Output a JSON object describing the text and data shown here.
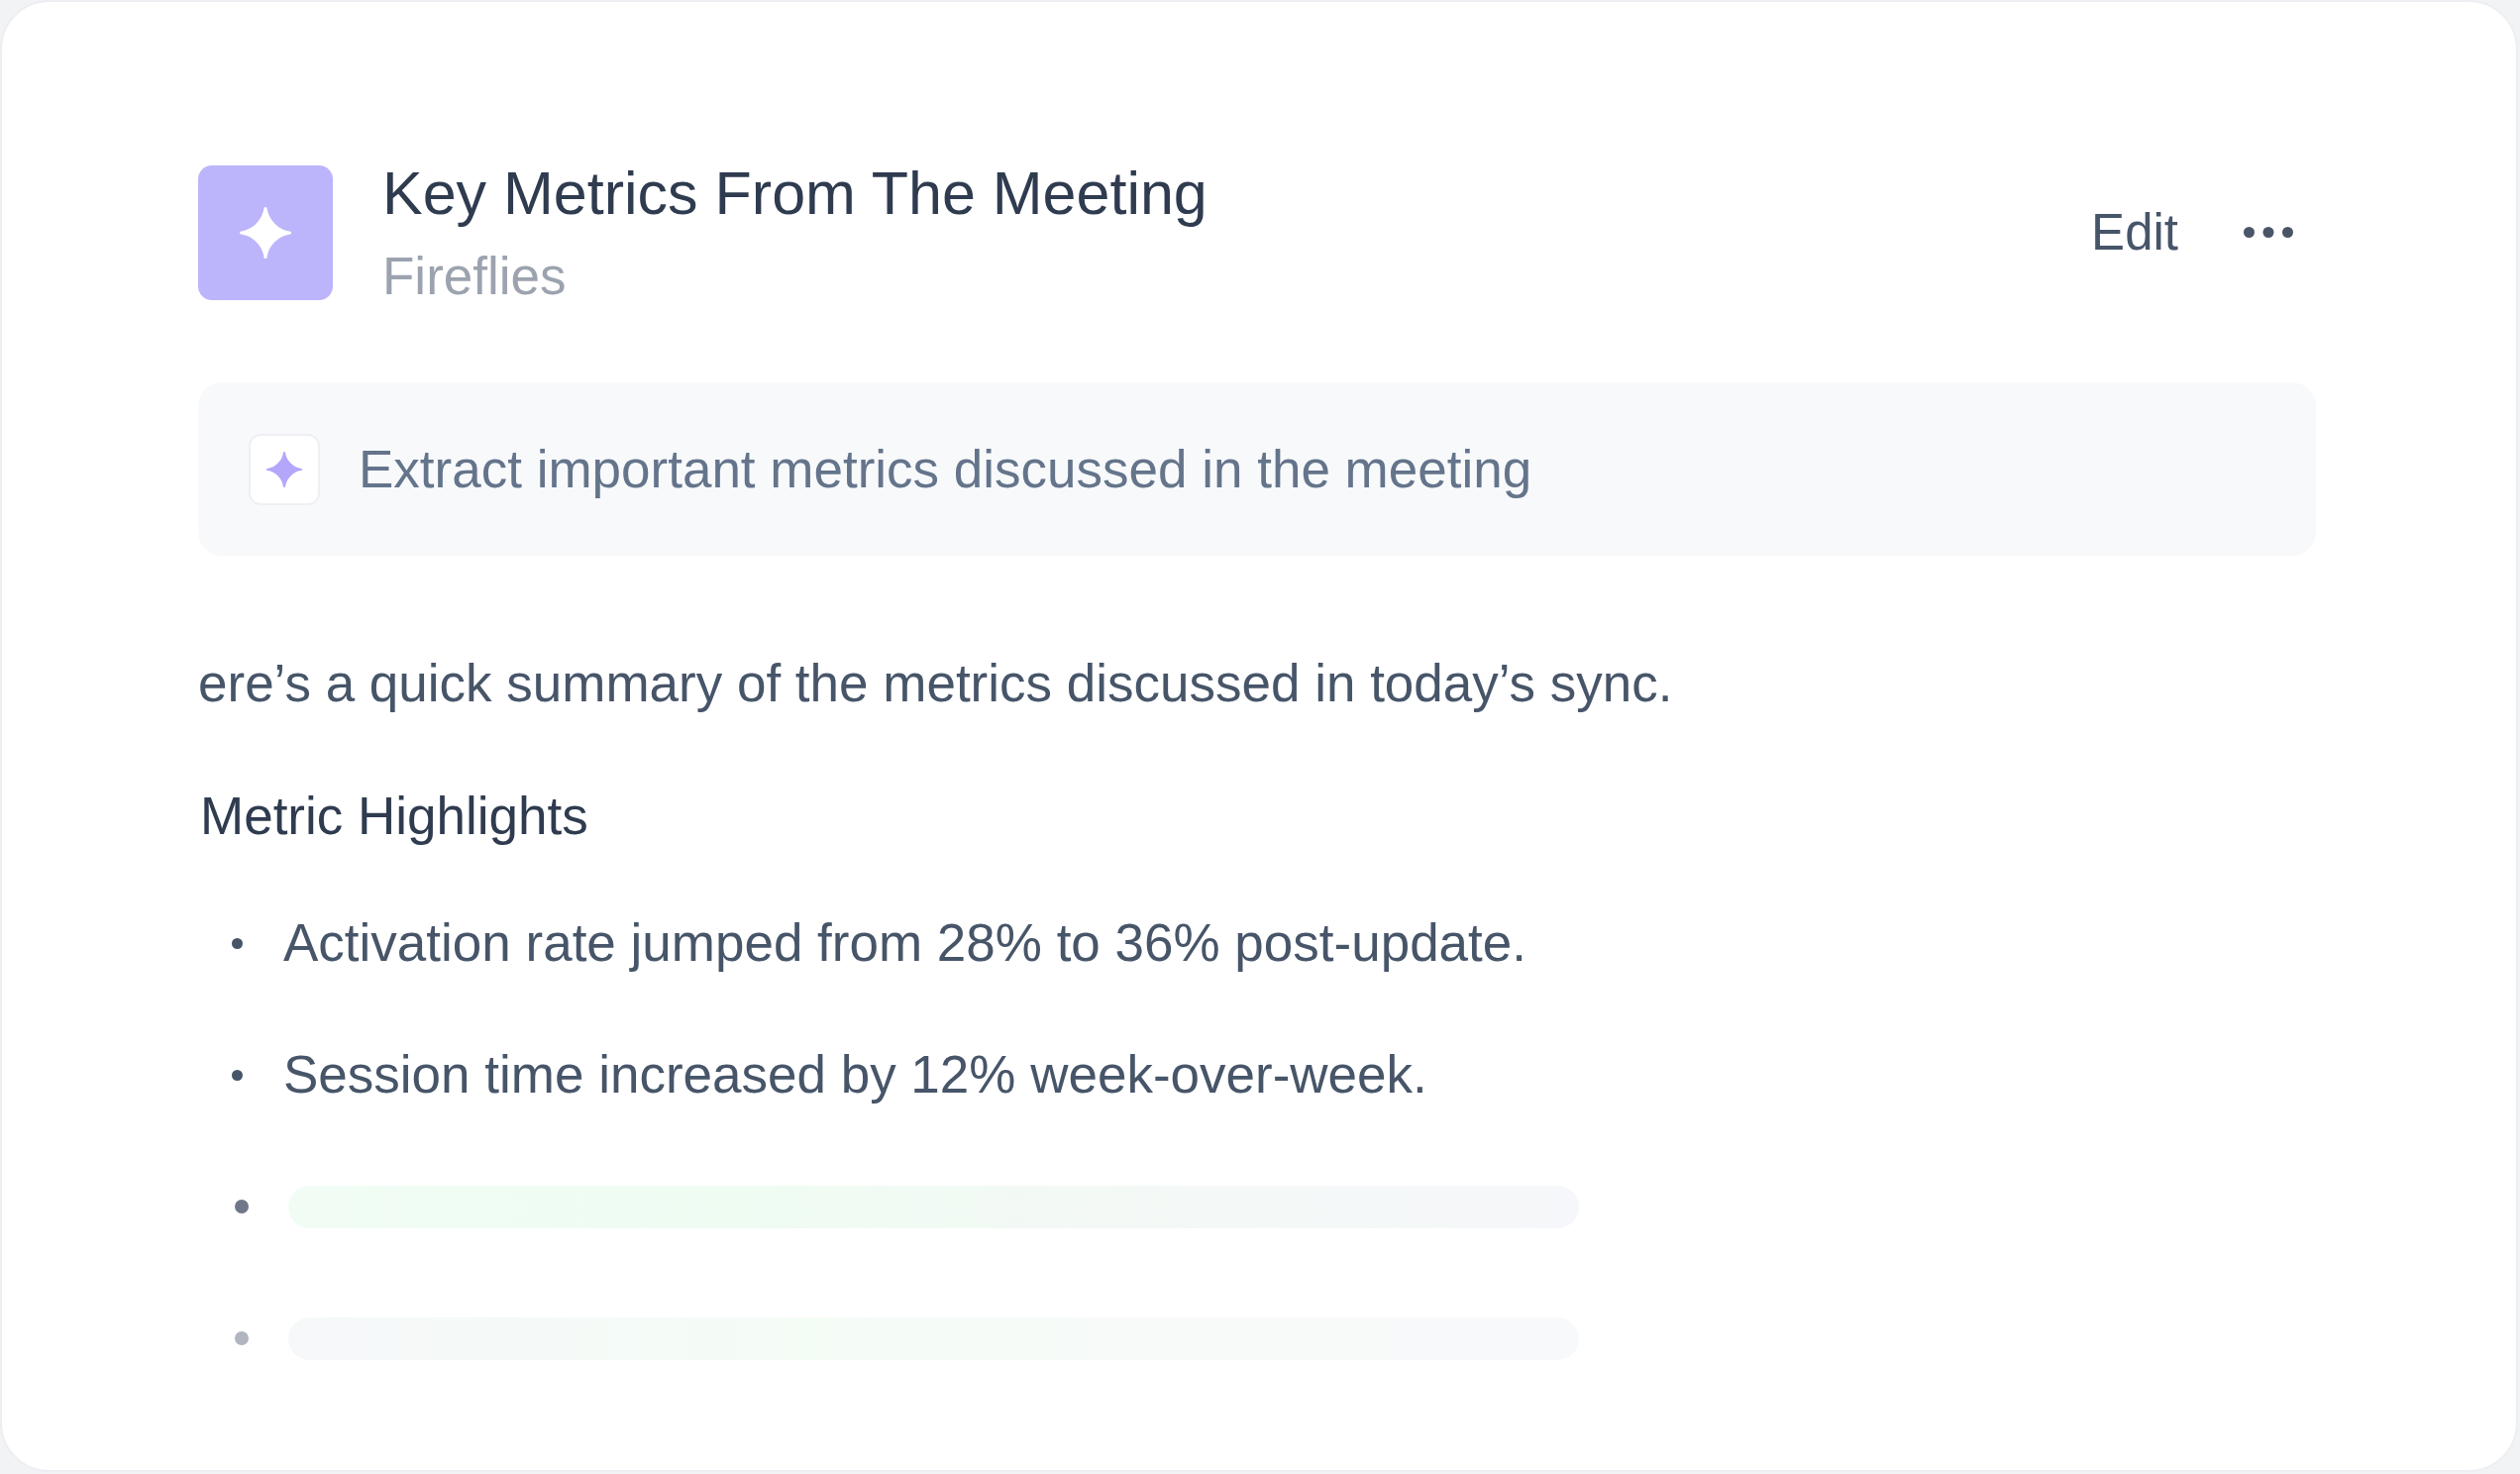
{
  "card": {
    "title": "Key Metrics From The Meeting",
    "source": "Fireflies",
    "edit_button": {
      "label": "Edit"
    },
    "prompt": {
      "text": "Extract important metrics discussed in the meeting"
    },
    "intro": "ere’s a quick summary of the metrics discussed in today’s sync.",
    "section_heading": "Metric Highlights",
    "highlights": [
      {
        "kind": "text",
        "text": "Activation rate jumped from 28% to 36% post-update."
      },
      {
        "kind": "text",
        "text": "Session time increased by 12% week-over-week."
      },
      {
        "kind": "loading",
        "faded": false
      },
      {
        "kind": "loading",
        "faded": true
      }
    ]
  }
}
